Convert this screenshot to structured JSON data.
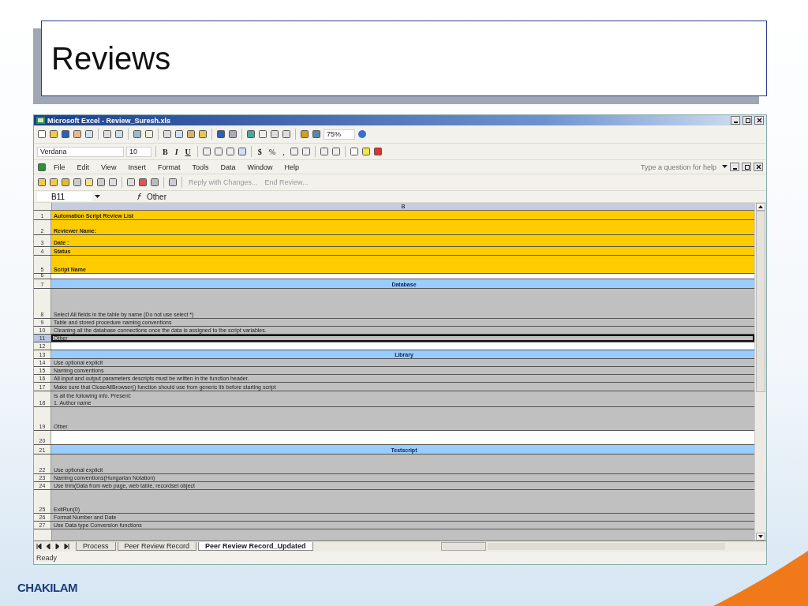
{
  "slide": {
    "title": "Reviews",
    "logo": "CHAKILAM"
  },
  "window": {
    "title": "Microsoft Excel - Review_Suresh.xls"
  },
  "standard_toolbar": {
    "zoom": "75%"
  },
  "formatting_toolbar": {
    "font": "Verdana",
    "size": "10",
    "bold": "B",
    "italic": "I",
    "underline": "U",
    "currency": "$",
    "percent": "%",
    "comma": ","
  },
  "menu": [
    "File",
    "Edit",
    "View",
    "Insert",
    "Format",
    "Tools",
    "Data",
    "Window",
    "Help"
  ],
  "help_box": {
    "placeholder": "Type a question for help"
  },
  "reviewing_toolbar": {
    "buttons": [
      "Reply with Changes...",
      "End Review..."
    ]
  },
  "formula_bar": {
    "name_box": "B11",
    "value": "Other"
  },
  "sheet": {
    "column_header": "B",
    "rows": [
      {
        "number": "1",
        "kind": "heading",
        "text": "Automation Script Review List",
        "selected": false
      },
      {
        "number": "2",
        "kind": "heading",
        "text": "Reviewer Name:",
        "selected": false
      },
      {
        "number": "3",
        "kind": "heading",
        "text": "Date :",
        "selected": false
      },
      {
        "number": "4",
        "kind": "heading",
        "text": "Status",
        "selected": false
      },
      {
        "number": "5",
        "kind": "heading",
        "text": "Script Name",
        "selected": false
      },
      {
        "number": "6",
        "kind": "blank",
        "selected": false
      },
      {
        "number": "7",
        "kind": "section",
        "text": "Database",
        "selected": false
      },
      {
        "number": "8",
        "kind": "item",
        "text": "Select All fields in the table by name (Do not use select *)",
        "selected": false
      },
      {
        "number": "9",
        "kind": "item",
        "text": "Table and stored procedure naming conventions",
        "selected": false
      },
      {
        "number": "10",
        "kind": "item",
        "text": "Cleaning all the database connections once the data is assigned to the script variables.",
        "selected": false
      },
      {
        "number": "11",
        "kind": "item",
        "text": "Other",
        "selected": true
      },
      {
        "number": "12",
        "kind": "blank",
        "selected": false
      },
      {
        "number": "13",
        "kind": "section",
        "text": "Library",
        "selected": false
      },
      {
        "number": "14",
        "kind": "item",
        "text": "Use optional explicit",
        "selected": false
      },
      {
        "number": "15",
        "kind": "item",
        "text": "Naming conventions",
        "selected": false
      },
      {
        "number": "16",
        "kind": "item",
        "text": "All input and output parameters descripts must be written in the function header.",
        "selected": false
      },
      {
        "number": "17",
        "kind": "item",
        "text": "Make sure that CloseAllBrowser() function should use from generic lib before starting script",
        "selected": false
      },
      {
        "number": "18",
        "kind": "item",
        "text": "Is all  the following info. Present:\n1. Author name",
        "selected": false
      },
      {
        "number": "19",
        "kind": "item",
        "text": "Other",
        "selected": false
      },
      {
        "number": "20",
        "kind": "blank",
        "selected": false
      },
      {
        "number": "21",
        "kind": "section",
        "text": "Testscript",
        "selected": false
      },
      {
        "number": "22",
        "kind": "item",
        "text": "Use optional explicit",
        "selected": false
      },
      {
        "number": "23",
        "kind": "item",
        "text": "Naming conventions(Hungarian Notation)",
        "selected": false
      },
      {
        "number": "24",
        "kind": "item",
        "text": "Use trim(Data from web page, web table, recordset object",
        "selected": false
      },
      {
        "number": "25",
        "kind": "item",
        "text": "ExitRun(0)",
        "selected": false
      },
      {
        "number": "26",
        "kind": "item",
        "text": "Format Number and Date",
        "selected": false
      },
      {
        "number": "27",
        "kind": "item",
        "text": "Use Data type Conversion functions",
        "selected": false
      }
    ]
  },
  "sheet_tabs": [
    {
      "label": "Process",
      "selected": false
    },
    {
      "label": "Peer Review Record",
      "selected": false
    },
    {
      "label": "Peer Review Record_Updated",
      "selected": true
    }
  ],
  "status_bar": "Ready"
}
